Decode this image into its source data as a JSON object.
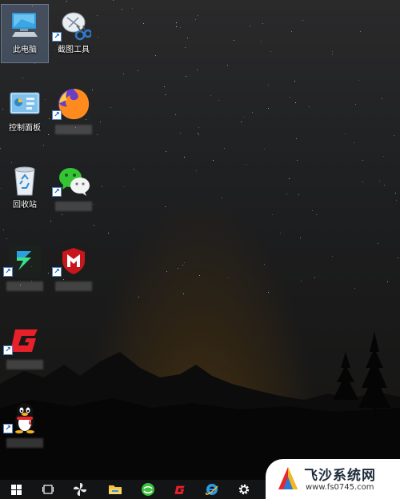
{
  "desktop": {
    "icons": [
      {
        "label": "此电脑"
      },
      {
        "label": "截图工具"
      },
      {
        "label": "控制面板"
      },
      {
        "label": "回收站"
      }
    ]
  },
  "watermark": {
    "title": "飞沙系统网",
    "url": "www.fs0745.com"
  },
  "colors": {
    "taskbar": "#121416",
    "accent_blue": "#2b9be8",
    "brand_red": "#e0262b"
  }
}
